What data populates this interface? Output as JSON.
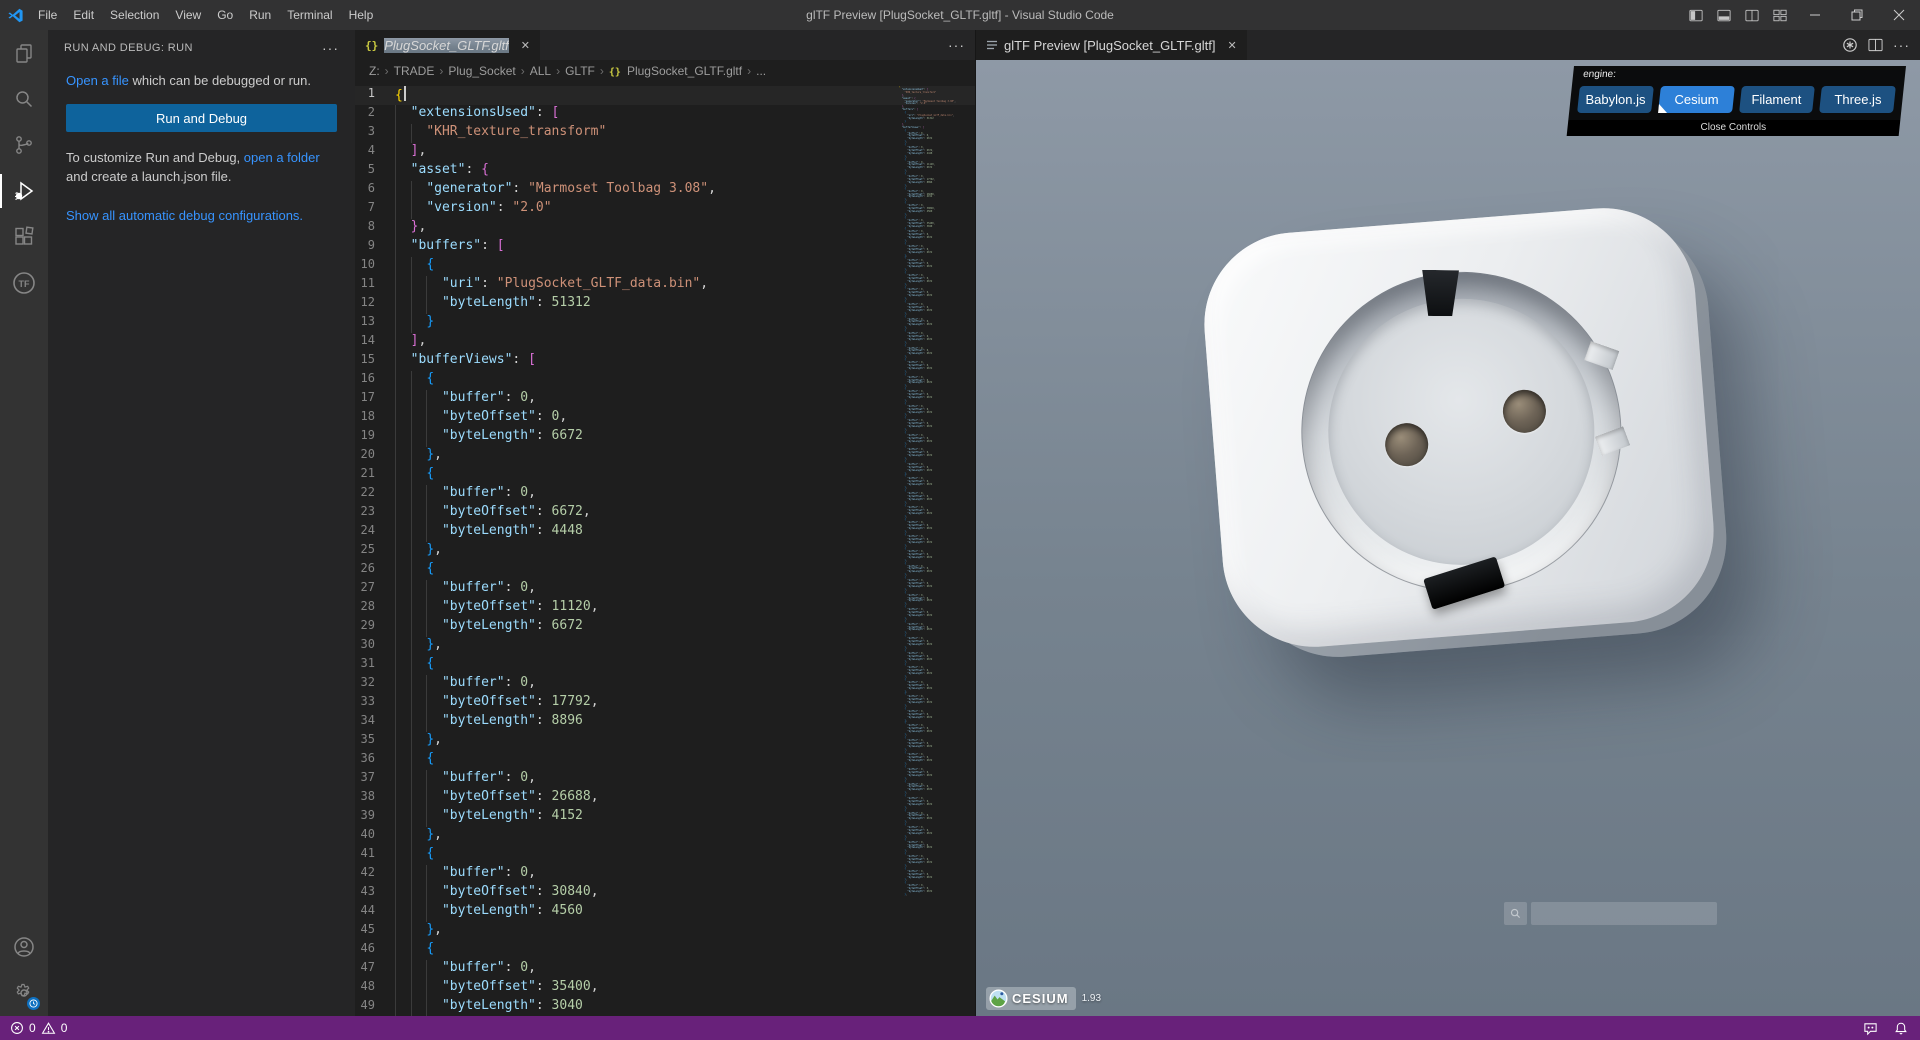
{
  "window": {
    "title": "glTF Preview [PlugSocket_GLTF.gltf] - Visual Studio Code",
    "menus": [
      "File",
      "Edit",
      "Selection",
      "View",
      "Go",
      "Run",
      "Terminal",
      "Help"
    ]
  },
  "sidebar": {
    "title": "RUN AND DEBUG: RUN",
    "more_glyph": "···",
    "open_file_link": "Open a file",
    "open_file_rest": " which can be debugged or run.",
    "run_button": "Run and Debug",
    "customize_pre": "To customize Run and Debug, ",
    "customize_link": "open a folder",
    "customize_post": " and create a launch.json file.",
    "show_all": "Show all automatic debug configurations."
  },
  "editor": {
    "tab_icon": "{}",
    "tab_title": "PlugSocket_GLTF.gltf",
    "close_glyph": "✕",
    "more_glyph": "···",
    "breadcrumb_separator": "›",
    "breadcrumb": [
      {
        "label": "Z:"
      },
      {
        "label": "TRADE"
      },
      {
        "label": "Plug_Socket"
      },
      {
        "label": "ALL"
      },
      {
        "label": "GLTF"
      },
      {
        "label": "PlugSocket_GLTF.gltf",
        "icon": "{}"
      },
      {
        "label": "..."
      }
    ],
    "code": [
      [
        [
          "{",
          "p1"
        ]
      ],
      [
        [
          "  ",
          ""
        ],
        [
          "\"extensionsUsed\"",
          "k"
        ],
        [
          ":",
          "d"
        ],
        [
          " ",
          ""
        ],
        [
          "[",
          "p2"
        ]
      ],
      [
        [
          "    ",
          ""
        ],
        [
          "\"KHR_texture_transform\"",
          "s"
        ]
      ],
      [
        [
          "  ",
          ""
        ],
        [
          "]",
          "p2"
        ],
        [
          ",",
          "d"
        ]
      ],
      [
        [
          "  ",
          ""
        ],
        [
          "\"asset\"",
          "k"
        ],
        [
          ":",
          "d"
        ],
        [
          " ",
          ""
        ],
        [
          "{",
          "p2"
        ]
      ],
      [
        [
          "    ",
          ""
        ],
        [
          "\"generator\"",
          "k"
        ],
        [
          ":",
          "d"
        ],
        [
          " ",
          ""
        ],
        [
          "\"Marmoset Toolbag 3.08\"",
          "s"
        ],
        [
          ",",
          "d"
        ]
      ],
      [
        [
          "    ",
          ""
        ],
        [
          "\"version\"",
          "k"
        ],
        [
          ":",
          "d"
        ],
        [
          " ",
          ""
        ],
        [
          "\"2.0\"",
          "s"
        ]
      ],
      [
        [
          "  ",
          ""
        ],
        [
          "}",
          "p2"
        ],
        [
          ",",
          "d"
        ]
      ],
      [
        [
          "  ",
          ""
        ],
        [
          "\"buffers\"",
          "k"
        ],
        [
          ":",
          "d"
        ],
        [
          " ",
          ""
        ],
        [
          "[",
          "p2"
        ]
      ],
      [
        [
          "    ",
          ""
        ],
        [
          "{",
          "p3"
        ]
      ],
      [
        [
          "      ",
          ""
        ],
        [
          "\"uri\"",
          "k"
        ],
        [
          ":",
          "d"
        ],
        [
          " ",
          ""
        ],
        [
          "\"PlugSocket_GLTF_data.bin\"",
          "s"
        ],
        [
          ",",
          "d"
        ]
      ],
      [
        [
          "      ",
          ""
        ],
        [
          "\"byteLength\"",
          "k"
        ],
        [
          ":",
          "d"
        ],
        [
          " ",
          ""
        ],
        [
          "51312",
          "n"
        ]
      ],
      [
        [
          "    ",
          ""
        ],
        [
          "}",
          "p3"
        ]
      ],
      [
        [
          "  ",
          ""
        ],
        [
          "]",
          "p2"
        ],
        [
          ",",
          "d"
        ]
      ],
      [
        [
          "  ",
          ""
        ],
        [
          "\"bufferViews\"",
          "k"
        ],
        [
          ":",
          "d"
        ],
        [
          " ",
          ""
        ],
        [
          "[",
          "p2"
        ]
      ],
      [
        [
          "    ",
          ""
        ],
        [
          "{",
          "p3"
        ]
      ],
      [
        [
          "      ",
          ""
        ],
        [
          "\"buffer\"",
          "k"
        ],
        [
          ":",
          "d"
        ],
        [
          " ",
          ""
        ],
        [
          "0",
          "n"
        ],
        [
          ",",
          "d"
        ]
      ],
      [
        [
          "      ",
          ""
        ],
        [
          "\"byteOffset\"",
          "k"
        ],
        [
          ":",
          "d"
        ],
        [
          " ",
          ""
        ],
        [
          "0",
          "n"
        ],
        [
          ",",
          "d"
        ]
      ],
      [
        [
          "      ",
          ""
        ],
        [
          "\"byteLength\"",
          "k"
        ],
        [
          ":",
          "d"
        ],
        [
          " ",
          ""
        ],
        [
          "6672",
          "n"
        ]
      ],
      [
        [
          "    ",
          ""
        ],
        [
          "}",
          "p3"
        ],
        [
          ",",
          "d"
        ]
      ],
      [
        [
          "    ",
          ""
        ],
        [
          "{",
          "p3"
        ]
      ],
      [
        [
          "      ",
          ""
        ],
        [
          "\"buffer\"",
          "k"
        ],
        [
          ":",
          "d"
        ],
        [
          " ",
          ""
        ],
        [
          "0",
          "n"
        ],
        [
          ",",
          "d"
        ]
      ],
      [
        [
          "      ",
          ""
        ],
        [
          "\"byteOffset\"",
          "k"
        ],
        [
          ":",
          "d"
        ],
        [
          " ",
          ""
        ],
        [
          "6672",
          "n"
        ],
        [
          ",",
          "d"
        ]
      ],
      [
        [
          "      ",
          ""
        ],
        [
          "\"byteLength\"",
          "k"
        ],
        [
          ":",
          "d"
        ],
        [
          " ",
          ""
        ],
        [
          "4448",
          "n"
        ]
      ],
      [
        [
          "    ",
          ""
        ],
        [
          "}",
          "p3"
        ],
        [
          ",",
          "d"
        ]
      ],
      [
        [
          "    ",
          ""
        ],
        [
          "{",
          "p3"
        ]
      ],
      [
        [
          "      ",
          ""
        ],
        [
          "\"buffer\"",
          "k"
        ],
        [
          ":",
          "d"
        ],
        [
          " ",
          ""
        ],
        [
          "0",
          "n"
        ],
        [
          ",",
          "d"
        ]
      ],
      [
        [
          "      ",
          ""
        ],
        [
          "\"byteOffset\"",
          "k"
        ],
        [
          ":",
          "d"
        ],
        [
          " ",
          ""
        ],
        [
          "11120",
          "n"
        ],
        [
          ",",
          "d"
        ]
      ],
      [
        [
          "      ",
          ""
        ],
        [
          "\"byteLength\"",
          "k"
        ],
        [
          ":",
          "d"
        ],
        [
          " ",
          ""
        ],
        [
          "6672",
          "n"
        ]
      ],
      [
        [
          "    ",
          ""
        ],
        [
          "}",
          "p3"
        ],
        [
          ",",
          "d"
        ]
      ],
      [
        [
          "    ",
          ""
        ],
        [
          "{",
          "p3"
        ]
      ],
      [
        [
          "      ",
          ""
        ],
        [
          "\"buffer\"",
          "k"
        ],
        [
          ":",
          "d"
        ],
        [
          " ",
          ""
        ],
        [
          "0",
          "n"
        ],
        [
          ",",
          "d"
        ]
      ],
      [
        [
          "      ",
          ""
        ],
        [
          "\"byteOffset\"",
          "k"
        ],
        [
          ":",
          "d"
        ],
        [
          " ",
          ""
        ],
        [
          "17792",
          "n"
        ],
        [
          ",",
          "d"
        ]
      ],
      [
        [
          "      ",
          ""
        ],
        [
          "\"byteLength\"",
          "k"
        ],
        [
          ":",
          "d"
        ],
        [
          " ",
          ""
        ],
        [
          "8896",
          "n"
        ]
      ],
      [
        [
          "    ",
          ""
        ],
        [
          "}",
          "p3"
        ],
        [
          ",",
          "d"
        ]
      ],
      [
        [
          "    ",
          ""
        ],
        [
          "{",
          "p3"
        ]
      ],
      [
        [
          "      ",
          ""
        ],
        [
          "\"buffer\"",
          "k"
        ],
        [
          ":",
          "d"
        ],
        [
          " ",
          ""
        ],
        [
          "0",
          "n"
        ],
        [
          ",",
          "d"
        ]
      ],
      [
        [
          "      ",
          ""
        ],
        [
          "\"byteOffset\"",
          "k"
        ],
        [
          ":",
          "d"
        ],
        [
          " ",
          ""
        ],
        [
          "26688",
          "n"
        ],
        [
          ",",
          "d"
        ]
      ],
      [
        [
          "      ",
          ""
        ],
        [
          "\"byteLength\"",
          "k"
        ],
        [
          ":",
          "d"
        ],
        [
          " ",
          ""
        ],
        [
          "4152",
          "n"
        ]
      ],
      [
        [
          "    ",
          ""
        ],
        [
          "}",
          "p3"
        ],
        [
          ",",
          "d"
        ]
      ],
      [
        [
          "    ",
          ""
        ],
        [
          "{",
          "p3"
        ]
      ],
      [
        [
          "      ",
          ""
        ],
        [
          "\"buffer\"",
          "k"
        ],
        [
          ":",
          "d"
        ],
        [
          " ",
          ""
        ],
        [
          "0",
          "n"
        ],
        [
          ",",
          "d"
        ]
      ],
      [
        [
          "      ",
          ""
        ],
        [
          "\"byteOffset\"",
          "k"
        ],
        [
          ":",
          "d"
        ],
        [
          " ",
          ""
        ],
        [
          "30840",
          "n"
        ],
        [
          ",",
          "d"
        ]
      ],
      [
        [
          "      ",
          ""
        ],
        [
          "\"byteLength\"",
          "k"
        ],
        [
          ":",
          "d"
        ],
        [
          " ",
          ""
        ],
        [
          "4560",
          "n"
        ]
      ],
      [
        [
          "    ",
          ""
        ],
        [
          "}",
          "p3"
        ],
        [
          ",",
          "d"
        ]
      ],
      [
        [
          "    ",
          ""
        ],
        [
          "{",
          "p3"
        ]
      ],
      [
        [
          "      ",
          ""
        ],
        [
          "\"buffer\"",
          "k"
        ],
        [
          ":",
          "d"
        ],
        [
          " ",
          ""
        ],
        [
          "0",
          "n"
        ],
        [
          ",",
          "d"
        ]
      ],
      [
        [
          "      ",
          ""
        ],
        [
          "\"byteOffset\"",
          "k"
        ],
        [
          ":",
          "d"
        ],
        [
          " ",
          ""
        ],
        [
          "35400",
          "n"
        ],
        [
          ",",
          "d"
        ]
      ],
      [
        [
          "      ",
          ""
        ],
        [
          "\"byteLength\"",
          "k"
        ],
        [
          ":",
          "d"
        ],
        [
          " ",
          ""
        ],
        [
          "3040",
          "n"
        ]
      ]
    ]
  },
  "preview": {
    "tab_title": "glTF Preview [PlugSocket_GLTF.gltf]",
    "close_glyph": "✕",
    "more_glyph": "···",
    "engine_panel": {
      "label": "engine:",
      "engines": [
        "Babylon.js",
        "Cesium",
        "Filament",
        "Three.js"
      ],
      "active": "Cesium",
      "close_label": "Close Controls"
    },
    "credit": {
      "brand": "CESIUM",
      "version": "1.93"
    },
    "geocoder_placeholder": ""
  },
  "status_bar": {
    "errors": "0",
    "warnings": "0"
  },
  "colors": {
    "accent_button": "#0e639c",
    "status_bar": "#68217A",
    "link": "#3794ff",
    "engine_active": "#2d80d8",
    "engine_inactive": "#1d5181"
  }
}
